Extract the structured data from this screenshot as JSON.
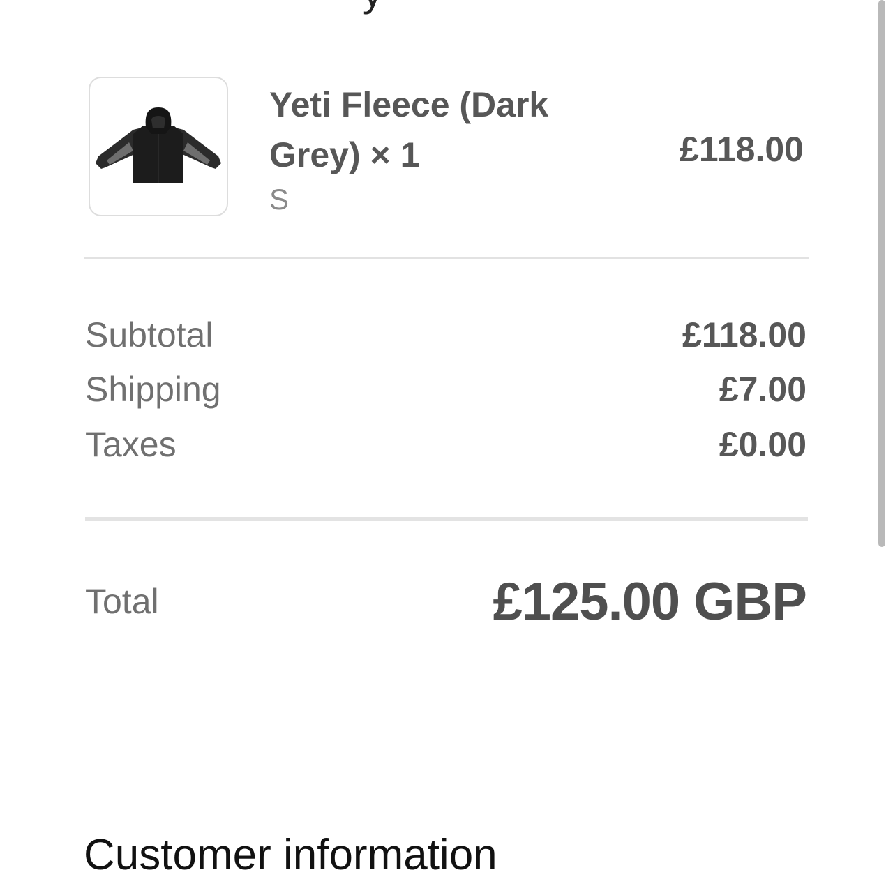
{
  "header": {
    "clipped_title_fragment": "y"
  },
  "order": {
    "item": {
      "thumbnail_icon": "jacket-icon",
      "name": "Yeti Fleece (Dark Grey) × 1",
      "variant": "S",
      "price": "£118.00"
    },
    "summary": [
      {
        "label": "Subtotal",
        "value": "£118.00"
      },
      {
        "label": "Shipping",
        "value": "£7.00"
      },
      {
        "label": "Taxes",
        "value": "£0.00"
      }
    ],
    "total": {
      "label": "Total",
      "value": "£125.00 GBP"
    }
  },
  "sections": {
    "customer_information_heading": "Customer information"
  }
}
